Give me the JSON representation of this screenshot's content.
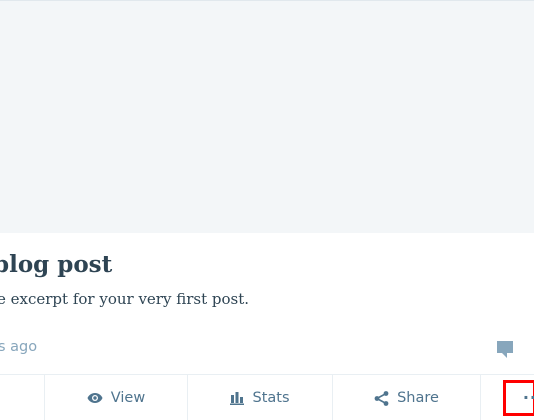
{
  "post": {
    "title": "blog post",
    "excerpt": "e excerpt for your very first post.",
    "time": "s ago"
  },
  "icons": {
    "comment": "comment-icon",
    "view": "eye-icon",
    "stats": "bar-chart-icon",
    "share": "share-icon",
    "more": "ellipsis-icon"
  },
  "actions": {
    "view_label": "View",
    "stats_label": "Stats",
    "share_label": "Share",
    "more_glyph": "··"
  },
  "colors": {
    "highlight": "#ff0000",
    "accent": "#4f748e",
    "muted": "#87a6bc",
    "title": "#2e4453",
    "image_placeholder": "#f3f6f8"
  }
}
